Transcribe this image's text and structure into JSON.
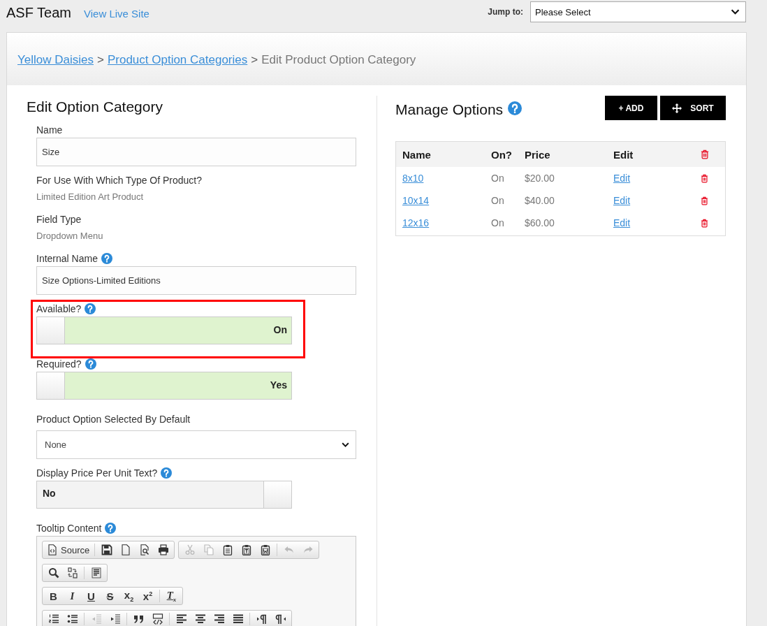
{
  "top_bar": {
    "title": "ASF Team",
    "link": "View Live Site",
    "jump_label": "Jump to:",
    "jump_value": "Please Select"
  },
  "breadcrumb": [
    {
      "kind": "link",
      "text": "Yellow Daisies"
    },
    {
      "kind": "separator",
      "text": ">"
    },
    {
      "kind": "link",
      "text": "Product Option Categories"
    },
    {
      "kind": "separator",
      "text": ">"
    },
    {
      "kind": "current",
      "text": "Edit Product Option Category"
    }
  ],
  "edit_panel": {
    "title": "Edit Option Category",
    "fields": [
      {
        "kind": "input",
        "label": "Name",
        "help": false,
        "highlighted": false,
        "value": "Size"
      },
      {
        "kind": "static",
        "label": "For Use With Which Type Of Product?",
        "help": false,
        "highlighted": false,
        "value": "Limited Edition Art Product"
      },
      {
        "kind": "static",
        "label": "Field Type",
        "help": false,
        "highlighted": false,
        "value": "Dropdown Menu"
      },
      {
        "kind": "input",
        "label": "Internal Name",
        "help": true,
        "highlighted": false,
        "value": "Size Options-Limited Editions"
      },
      {
        "kind": "toggle",
        "label": "Available?",
        "help": true,
        "highlighted": true,
        "on": true,
        "text": "On"
      },
      {
        "kind": "toggle",
        "label": "Required?",
        "help": true,
        "highlighted": false,
        "on": true,
        "text": "Yes"
      },
      {
        "kind": "select",
        "label": "Product Option Selected By Default",
        "help": false,
        "highlighted": false,
        "value": "None"
      },
      {
        "kind": "toggle",
        "label": "Display Price Per Unit Text?",
        "help": true,
        "highlighted": false,
        "on": false,
        "text": "No"
      },
      {
        "kind": "editor",
        "label": "Tooltip Content",
        "help": true,
        "highlighted": false,
        "toolbar": [
          {
            "groups": [
              {
                "sections": [
                  [
                    {
                      "kind": "source",
                      "label": "Source",
                      "disabled": false
                    }
                  ],
                  [
                    {
                      "kind": "save",
                      "disabled": false
                    },
                    {
                      "kind": "newpage",
                      "disabled": false
                    },
                    {
                      "kind": "preview",
                      "disabled": false
                    },
                    {
                      "kind": "print",
                      "disabled": false
                    }
                  ]
                ]
              },
              {
                "sections": [
                  [
                    {
                      "kind": "cut",
                      "disabled": true
                    },
                    {
                      "kind": "copy",
                      "disabled": true
                    },
                    {
                      "kind": "paste",
                      "disabled": false
                    },
                    {
                      "kind": "pastetext",
                      "disabled": false
                    },
                    {
                      "kind": "pasteword",
                      "disabled": false
                    }
                  ],
                  [
                    {
                      "kind": "undo",
                      "disabled": true
                    },
                    {
                      "kind": "redo",
                      "disabled": true
                    }
                  ]
                ]
              }
            ]
          },
          {
            "groups": [
              {
                "sections": [
                  [
                    {
                      "kind": "find",
                      "disabled": false
                    },
                    {
                      "kind": "replace",
                      "disabled": false
                    }
                  ],
                  [
                    {
                      "kind": "selectall",
                      "disabled": false
                    }
                  ]
                ]
              }
            ]
          },
          {
            "groups": [
              {
                "sections": [
                  [
                    {
                      "kind": "bold",
                      "label": "B",
                      "disabled": false
                    },
                    {
                      "kind": "italic",
                      "label": "I",
                      "disabled": false
                    },
                    {
                      "kind": "underline",
                      "label": "U",
                      "disabled": false
                    },
                    {
                      "kind": "strike",
                      "label": "S",
                      "disabled": false
                    },
                    {
                      "kind": "subscript",
                      "label": "x$_{2}$",
                      "disabled": false
                    },
                    {
                      "kind": "superscript",
                      "label": "x$^{2}$",
                      "disabled": false
                    }
                  ],
                  [
                    {
                      "kind": "removeformat",
                      "label": "T$_{x}$",
                      "disabled": false
                    }
                  ]
                ]
              }
            ]
          },
          {
            "groups": [
              {
                "sections": [
                  [
                    {
                      "kind": "numlist",
                      "disabled": false
                    },
                    {
                      "kind": "bulletlist",
                      "disabled": false
                    }
                  ],
                  [
                    {
                      "kind": "outdent",
                      "disabled": true
                    },
                    {
                      "kind": "indent",
                      "disabled": false
                    }
                  ],
                  [
                    {
                      "kind": "blockquote",
                      "disabled": false
                    },
                    {
                      "kind": "div",
                      "disabled": false
                    }
                  ],
                  [
                    {
                      "kind": "alignleft",
                      "disabled": false
                    },
                    {
                      "kind": "aligncenter",
                      "disabled": false
                    },
                    {
                      "kind": "alignright",
                      "disabled": false
                    },
                    {
                      "kind": "justify",
                      "disabled": false
                    }
                  ],
                  [
                    {
                      "kind": "ltr",
                      "disabled": false
                    },
                    {
                      "kind": "rtl",
                      "disabled": false
                    }
                  ]
                ]
              }
            ]
          }
        ]
      }
    ]
  },
  "options_panel": {
    "title": "Manage Options",
    "help": true,
    "buttons": [
      {
        "kind": "add",
        "label": "+ ADD"
      },
      {
        "kind": "sort",
        "label": "SORT"
      }
    ],
    "columns": [
      "Name",
      "On?",
      "Price",
      "Edit"
    ],
    "rows": [
      {
        "name": "8x10",
        "on": "On",
        "price": "$20.00",
        "edit": "Edit"
      },
      {
        "name": "10x14",
        "on": "On",
        "price": "$40.00",
        "edit": "Edit"
      },
      {
        "name": "12x16",
        "on": "On",
        "price": "$60.00",
        "edit": "Edit"
      }
    ]
  }
}
